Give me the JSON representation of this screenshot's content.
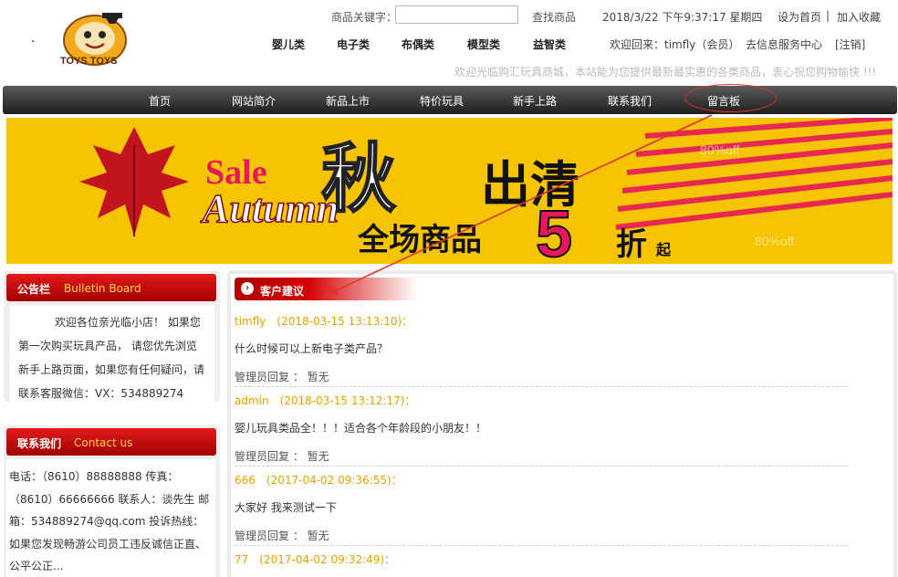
{
  "header": {
    "search_label": "商品关键字：",
    "search_value": "",
    "search_button": "查找商品",
    "datetime": "2018/3/22 下午9:37:17 星期四",
    "set_home": "设为首页",
    "separator": "|",
    "add_favorite": "加入收藏",
    "categories": [
      "婴儿类",
      "电子类",
      "布偶类",
      "模型类",
      "益智类"
    ],
    "welcome": "欢迎回来：timfly（会员）",
    "service_center": "去信息服务中心",
    "logout": "[注销]",
    "marquee": "欢迎光临购汇玩具商城，本站能为您提供最新最实惠的各类商品，衷心祝您购物愉快 !!!"
  },
  "nav": [
    "首页",
    "网站简介",
    "新品上市",
    "特价玩具",
    "新手上路",
    "联系我们",
    "留言板"
  ],
  "banner": {
    "sale": "Sale",
    "autumn": "Autumn",
    "char_qiu": "秋",
    "chuqing": "出清",
    "allgoods": "全场商品",
    "five": "5",
    "zhe": "折",
    "qi": "起",
    "deco_off": "80%off"
  },
  "bulletin": {
    "title": "公告栏",
    "subtitle": "Bulletin Board",
    "text": "欢迎各位亲光临小店！ 如果您第一次购买玩具产品， 请您优先浏览新手上路页面，如果您有任何疑问，请联系客服微信：VX：534889274"
  },
  "contact": {
    "title": "联系我们",
    "subtitle": "Contact us",
    "text": "电话：（8610）88888888 传真：（8610）66666666 联系人：谈先生 邮箱：534889274@qq.com 投诉热线：如果您发现畅游公司员工违反诚信正直、公平公正..."
  },
  "main": {
    "section_title": "客户建议",
    "messages": [
      {
        "head": "timfly　(2018-03-15 13:13:10)：",
        "body": "什么时候可以上新电子类产品？",
        "reply": "管理员回复 ： 暂无"
      },
      {
        "head": "admin　(2018-03-15 13:12:17)：",
        "body": "婴儿玩具类品全！！！适合各个年龄段的小朋友！！",
        "reply": "管理员回复 ： 暂无"
      },
      {
        "head": "666　(2017-04-02 09:36:55)：",
        "body": "大家好 我来测试一下",
        "reply": "管理员回复 ： 暂无"
      },
      {
        "head": "77　(2017-04-02 09:32:49)：",
        "body": "",
        "reply": ""
      }
    ]
  },
  "colors": {
    "accent_red": "#c40000",
    "msg_head": "#e8a000",
    "banner_bg": "#f6c400"
  }
}
